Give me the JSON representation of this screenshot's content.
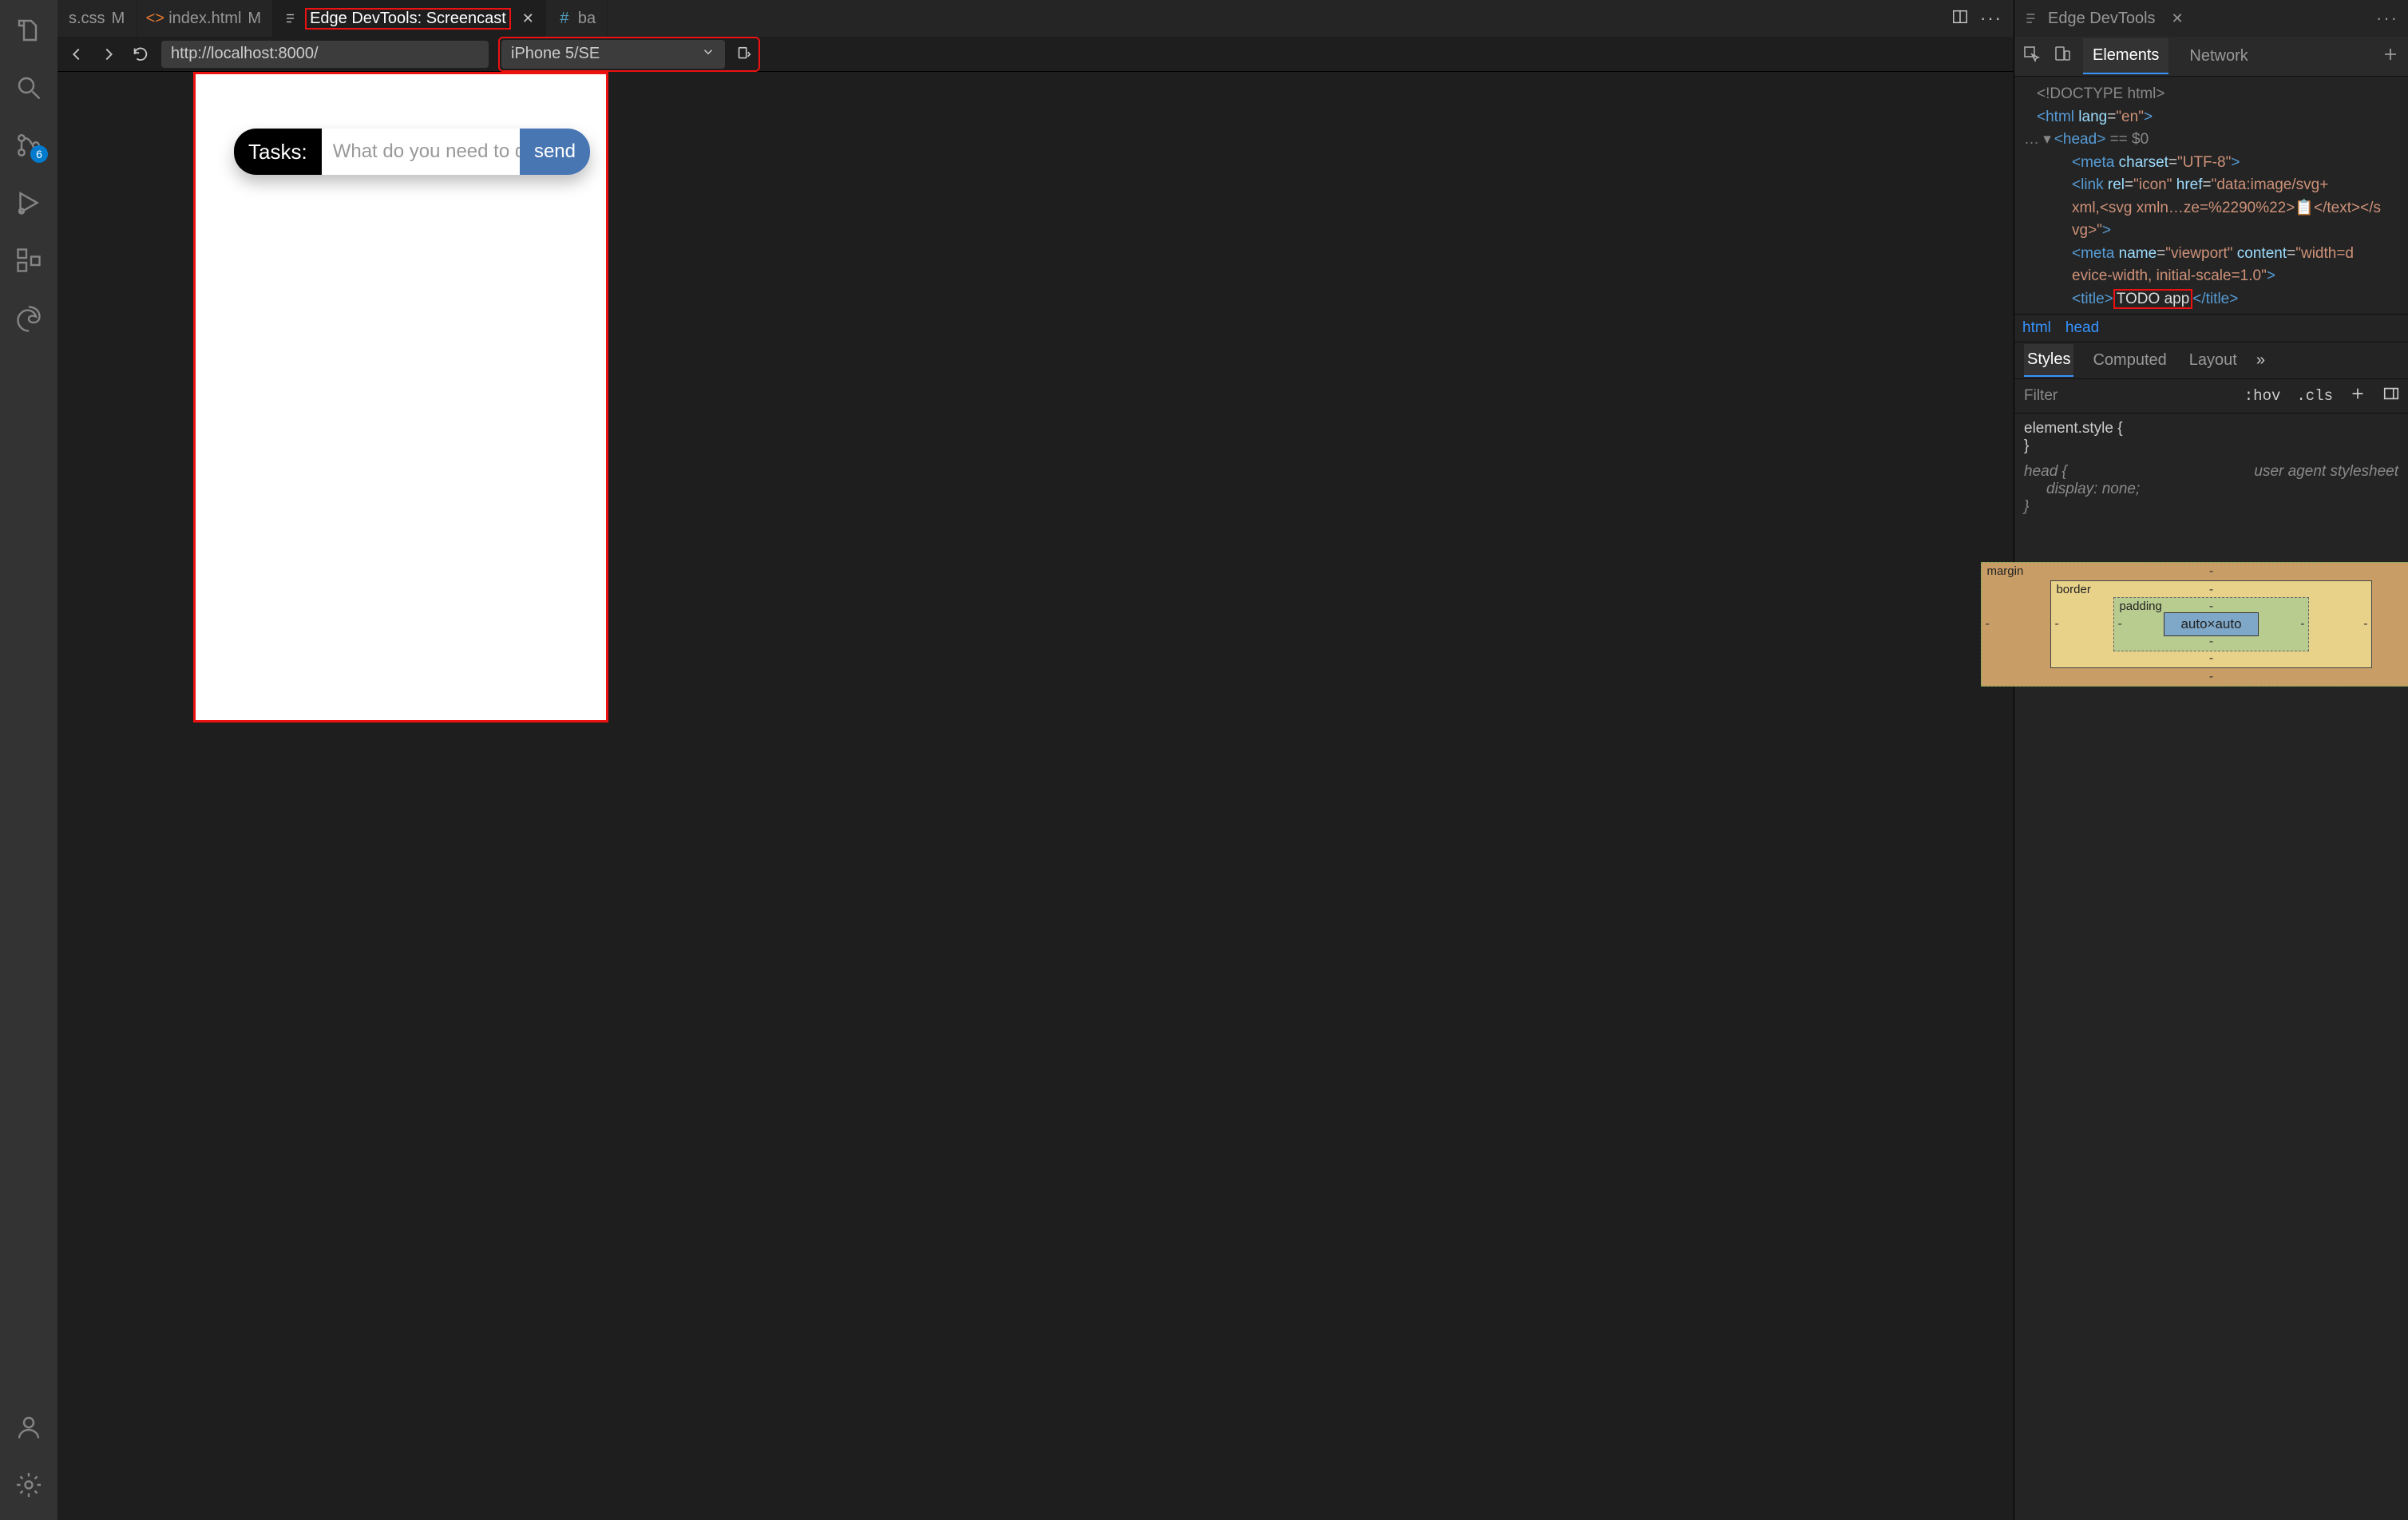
{
  "activity": {
    "scm_badge": "6"
  },
  "tabs": {
    "css": {
      "label": "s.css",
      "modified": "M"
    },
    "html": {
      "label": "index.html",
      "modified": "M"
    },
    "screencast": {
      "label": "Edge DevTools: Screencast"
    },
    "base": {
      "label": "ba"
    }
  },
  "navbar": {
    "url": "http://localhost:8000/",
    "device": "iPhone 5/SE"
  },
  "app_preview": {
    "tasks_label": "Tasks:",
    "placeholder": "What do you need to do",
    "send": "send"
  },
  "devtools": {
    "panel_title": "Edge DevTools",
    "tabs": {
      "elements": "Elements",
      "network": "Network"
    },
    "dom": {
      "doctype": "<!DOCTYPE html>",
      "html_open": "<html lang=\"en\">",
      "head_summary_prefix": "<head>",
      "head_summary_suffix": " == $0",
      "meta_charset": "<meta charset=\"UTF-8\">",
      "link_icon_a": "<link rel=\"icon\" href=\"data:image/svg+",
      "link_icon_b": "xml,<svg xmln…ze=%2290%22>📋</text></s",
      "link_icon_c": "vg>\">",
      "meta_viewport_a": "<meta name=\"viewport\" content=\"width=d",
      "meta_viewport_b": "evice-width, initial-scale=1.0\">",
      "title_open": "<title>",
      "title_text": "TODO app",
      "title_close": "</title>"
    },
    "crumbs": {
      "html": "html",
      "head": "head"
    },
    "styles_tabs": {
      "styles": "Styles",
      "computed": "Computed",
      "layout": "Layout"
    },
    "filter": {
      "placeholder": "Filter",
      "hov": ":hov",
      "cls": ".cls"
    },
    "rules": {
      "element_style": "element.style {",
      "brace_close": "}",
      "head_sel": "head {",
      "display_none": "display: none;",
      "ua_label": "user agent stylesheet"
    },
    "boxmodel": {
      "margin": "margin",
      "border": "border",
      "padding": "padding",
      "content": "auto×auto",
      "dash": "-"
    }
  }
}
